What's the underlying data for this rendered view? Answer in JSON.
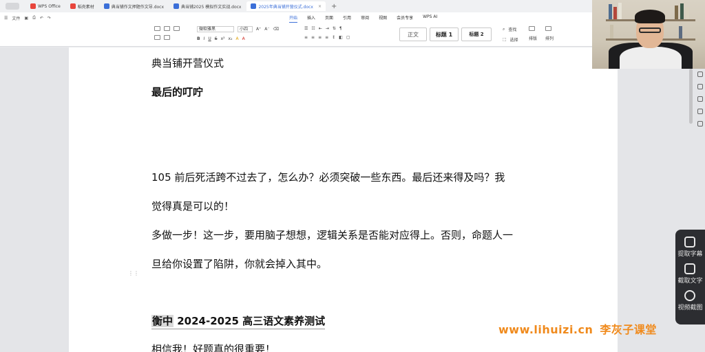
{
  "tabs": [
    {
      "label": "WPS Office",
      "color": "#e8453c",
      "active": false
    },
    {
      "label": "稻壳素材",
      "color": "#e8453c",
      "active": false
    },
    {
      "label": "典当铺作文押题作文导.docx",
      "color": "#3b6fd8",
      "active": false
    },
    {
      "label": "典当铺2025 模拟作文实战.docx",
      "color": "#3b6fd8",
      "active": false
    },
    {
      "label": "2025年典当铺开营仪式.docx",
      "color": "#3b6fd8",
      "active": true
    }
  ],
  "menu": {
    "file_label": "文件",
    "tabs": [
      "开始",
      "插入",
      "页面",
      "引用",
      "审阅",
      "视图",
      "会员专享",
      "WPS AI"
    ],
    "active_tab": "开始"
  },
  "ribbon": {
    "font_name": "微软雅黑",
    "font_size": "小四",
    "style_normal": "正文",
    "style_h1": "标题 1",
    "style_h2": "标题 2",
    "find_label": "查找",
    "select_label": "选择",
    "layout_label": "排版",
    "arrange_label": "排列"
  },
  "document": {
    "title": "典当铺开营仪式",
    "subtitle": "最后的叮咛",
    "para1_line1": "105 前后死活跨不过去了，怎么办？必须突破一些东西。最后还来得及吗？我",
    "para1_line2": "觉得真是可以的！",
    "para2_line1": "多做一步！这一步，要用脑子想想，逻辑关系是否能对应得上。否则，命题人一",
    "para2_line2": "旦给你设置了陷阱，你就会掉入其中。",
    "heading_first": "衡中",
    "heading_rest": " 2024-2025 高三语文素养测试",
    "last_line": "相信我！好题真的很重要！"
  },
  "float_panel": {
    "extract_subtitle": "提取字幕",
    "extract_text": "截取文字",
    "screenshot": "视频截图"
  },
  "watermark": {
    "url": "www.lihuizi.cn",
    "brand": "李灰子课堂",
    "color": "#f08a1c"
  }
}
